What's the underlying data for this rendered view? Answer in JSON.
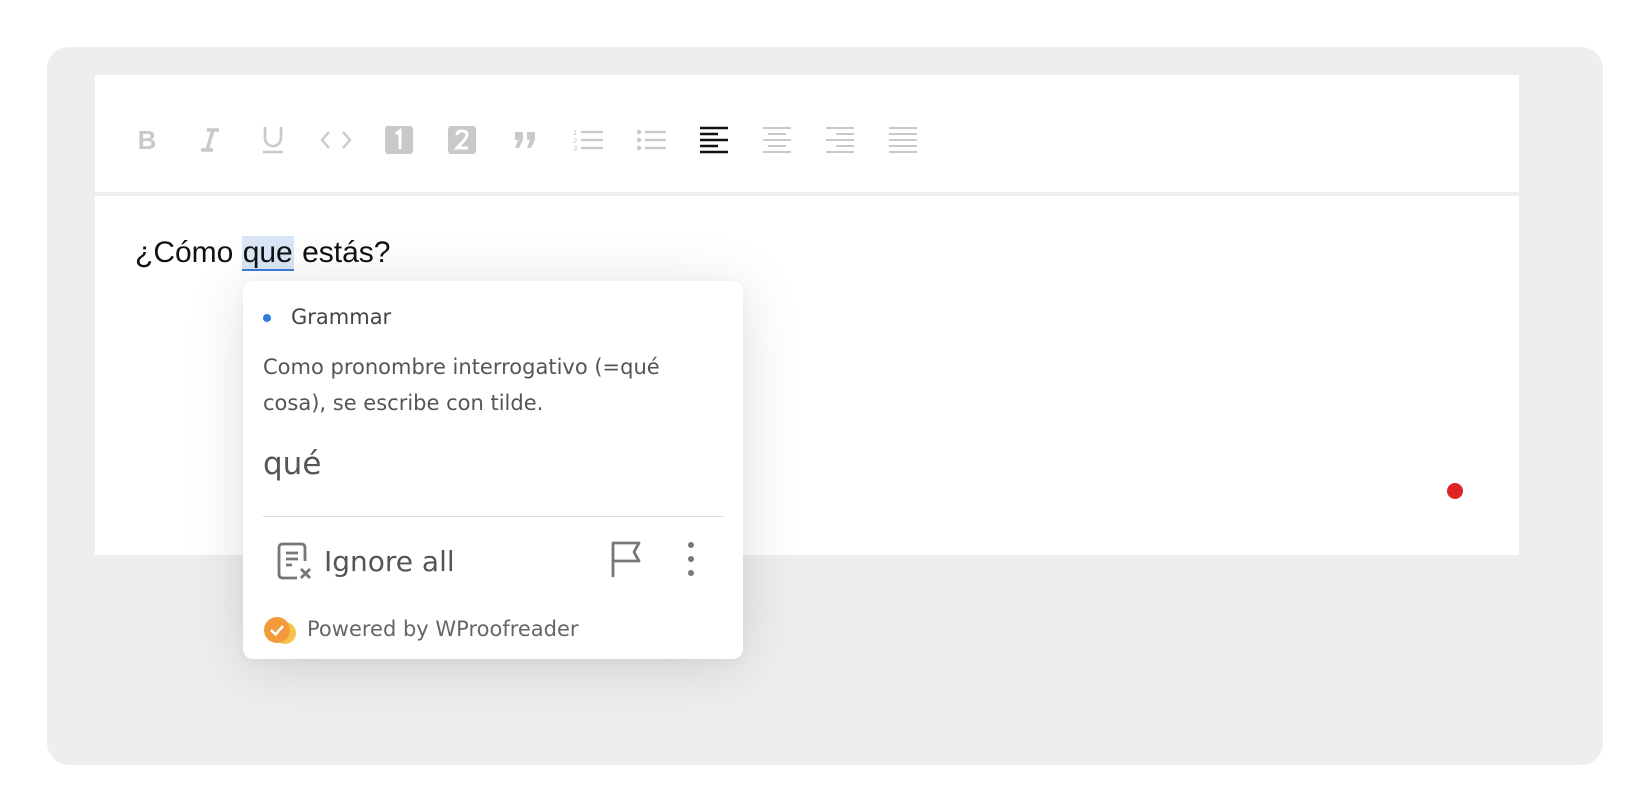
{
  "editor": {
    "toolbar": {
      "bold": "B",
      "numbered_heading_1": "1",
      "numbered_heading_2": "2",
      "active_alignment": "align-left"
    },
    "text": {
      "before": "¿Cómo ",
      "flagged": "que",
      "after": " estás?"
    }
  },
  "popup": {
    "category": "Grammar",
    "category_color": "#2f7be0",
    "description": "Como pronombre interrogativo (=qué cosa), se escribe con tilde.",
    "suggestion": "qué",
    "ignore_all_label": "Ignore all",
    "powered_by": "Powered by WProofreader"
  },
  "colors": {
    "outer_background": "#eeeeee",
    "highlight": "#d9e6f6",
    "status_dot": "#e02424",
    "brand_orange": "#f39a3a"
  }
}
